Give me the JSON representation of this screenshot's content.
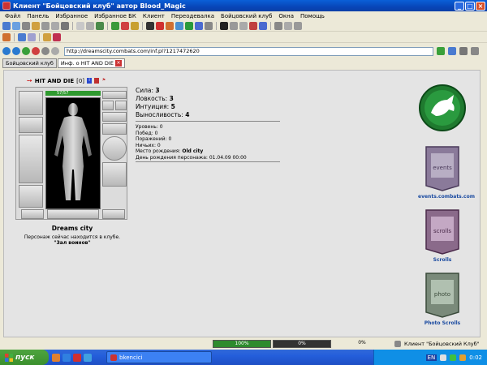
{
  "window": {
    "title": "Клиент \"Бойцовский клуб\" автор Blood_Magic"
  },
  "menu": [
    "Файл",
    "Панель",
    "Избранное",
    "Избранное БК",
    "Клиент",
    "Переодевалка",
    "Бойцовский клуб",
    "Окна",
    "Помощь"
  ],
  "address": {
    "url": "http://dreamscity.combats.com/inf.pl?1217472620"
  },
  "tabs": [
    {
      "label": "Бойцовский клуб",
      "active": false
    },
    {
      "label": "Инф. о HIT AND DIE",
      "active": true
    }
  ],
  "character": {
    "name": "HIT AND DIE",
    "level": "[0]",
    "hp": "57/57",
    "hp_fraction": 1.0,
    "stats": [
      {
        "label": "Сила:",
        "value": "3"
      },
      {
        "label": "Ловкость:",
        "value": "3"
      },
      {
        "label": "Интуиция:",
        "value": "5"
      },
      {
        "label": "Выносливость:",
        "value": "4"
      }
    ],
    "info": [
      {
        "label": "Уровень:",
        "value": "0"
      },
      {
        "label": "Побед:",
        "value": "0"
      },
      {
        "label": "Поражений:",
        "value": "0"
      },
      {
        "label": "Ничьих:",
        "value": "0"
      },
      {
        "label": "Место рождения:",
        "value": "Old city",
        "bold": true
      },
      {
        "label": "День рождения персонажа:",
        "value": "01.04.09 00:00"
      }
    ],
    "city": "Dreams city",
    "location_msg": "Персонаж сейчас находится в клубе.",
    "room": "\"Зал воинов\""
  },
  "promos": [
    {
      "label": "events.combats.com",
      "icon": "events-banner-icon"
    },
    {
      "label": "Scrolls",
      "icon": "scrolls-banner-icon"
    },
    {
      "label": "Photo Scrolls",
      "icon": "photo-banner-icon"
    }
  ],
  "status": {
    "progress1": "100%",
    "progress1_fraction": 1.0,
    "progress2": "0%",
    "progress2_fraction": 0.0,
    "progress3": "0%",
    "client": "Клиент \"Бойцовский Клуб\""
  },
  "taskbar": {
    "start": "пуск",
    "task": "bkencici",
    "lang": "EN",
    "clock": "0:02"
  },
  "colors": {
    "xp_blue": "#0a5fd8",
    "hp_green": "#2f9a2f",
    "brand_green": "#1f7a2f",
    "banner_purple": "#7b6f8f"
  }
}
